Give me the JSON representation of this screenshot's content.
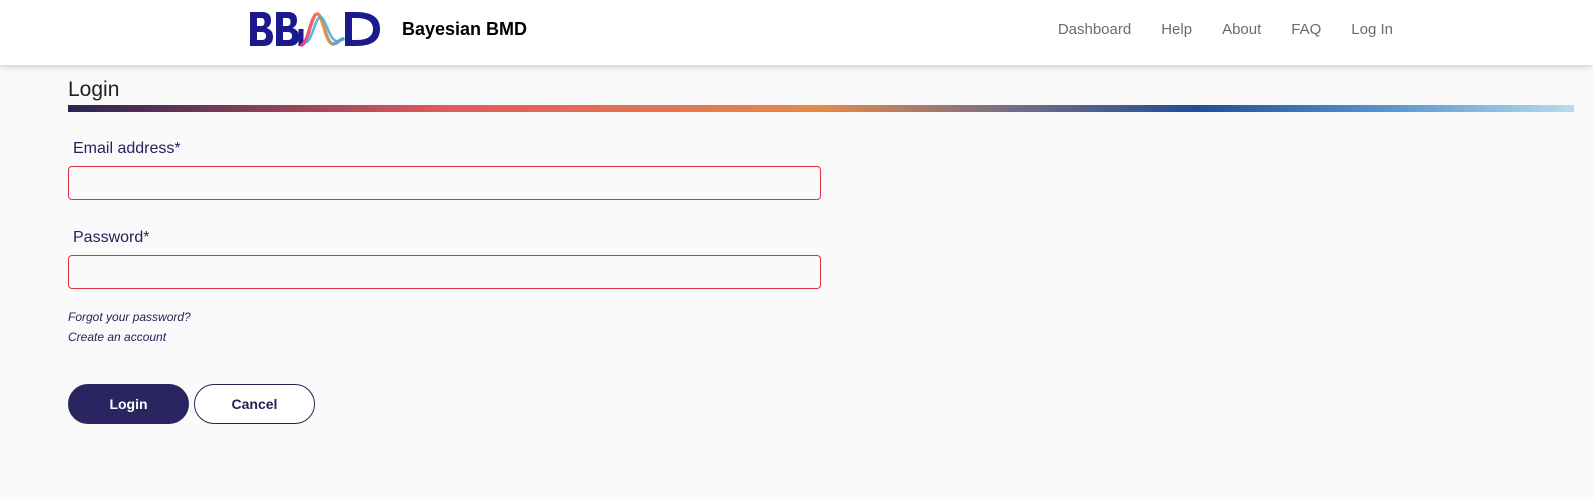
{
  "header": {
    "logo_text": "BBMD",
    "app_title": "Bayesian BMD",
    "nav": [
      {
        "label": "Dashboard"
      },
      {
        "label": "Help"
      },
      {
        "label": "About"
      },
      {
        "label": "FAQ"
      },
      {
        "label": "Log In"
      }
    ]
  },
  "page": {
    "title": "Login"
  },
  "form": {
    "email": {
      "label": "Email address*",
      "value": "",
      "placeholder": ""
    },
    "password": {
      "label": "Password*",
      "value": "",
      "placeholder": ""
    },
    "forgot_link": "Forgot your password?",
    "create_link": "Create an account",
    "login_button": "Login",
    "cancel_button": "Cancel"
  },
  "colors": {
    "brand_navy": "#2a2560",
    "logo_blue": "#1a1a8c",
    "error_border": "#e0303e",
    "nav_text": "#6b6b6b"
  },
  "icons": {
    "logo": "bbmd-logo"
  }
}
